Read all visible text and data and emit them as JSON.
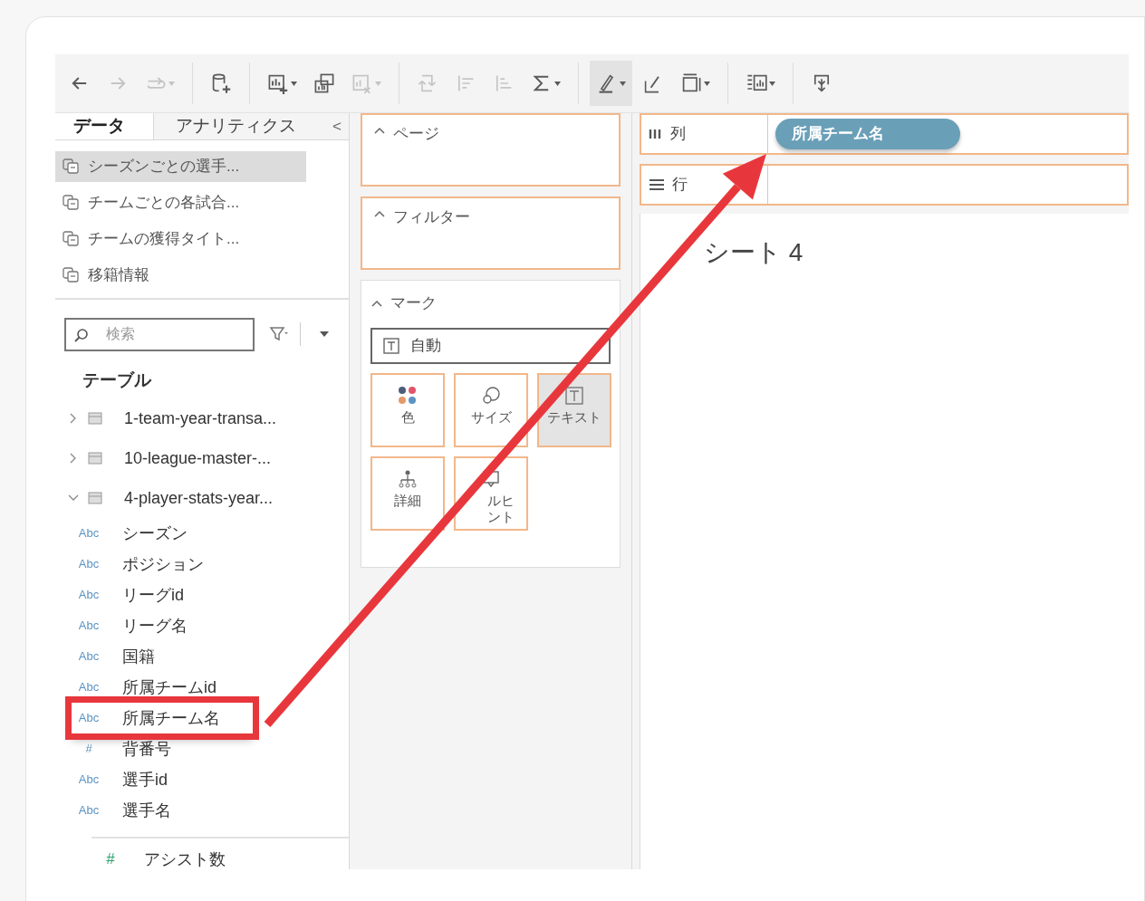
{
  "toolbar": [
    {
      "kind": "back",
      "disabled": false,
      "dropdown": false
    },
    {
      "kind": "forward",
      "disabled": true,
      "dropdown": false
    },
    {
      "kind": "redo",
      "disabled": true,
      "dropdown": true
    },
    {
      "kind": "separator"
    },
    {
      "kind": "new-datasource",
      "disabled": false,
      "dropdown": false
    },
    {
      "kind": "separator"
    },
    {
      "kind": "new-sheet",
      "disabled": false,
      "dropdown": true
    },
    {
      "kind": "duplicate",
      "disabled": false,
      "dropdown": false
    },
    {
      "kind": "clear",
      "disabled": true,
      "dropdown": true
    },
    {
      "kind": "separator"
    },
    {
      "kind": "swap",
      "disabled": true,
      "dropdown": false
    },
    {
      "kind": "sort-asc",
      "disabled": true,
      "dropdown": false
    },
    {
      "kind": "sort-desc",
      "disabled": true,
      "dropdown": false
    },
    {
      "kind": "totals",
      "disabled": false,
      "dropdown": true
    },
    {
      "kind": "separator"
    },
    {
      "kind": "highlight",
      "disabled": false,
      "dropdown": true,
      "pressed": true
    },
    {
      "kind": "annotate",
      "disabled": false,
      "dropdown": false
    },
    {
      "kind": "frame",
      "disabled": false,
      "dropdown": true
    },
    {
      "kind": "separator"
    },
    {
      "kind": "show-me",
      "disabled": false,
      "dropdown": true
    },
    {
      "kind": "separator"
    },
    {
      "kind": "present",
      "disabled": false,
      "dropdown": false
    }
  ],
  "data_pane": {
    "tabs": [
      {
        "label": "データ",
        "selected": true
      },
      {
        "label": "アナリティクス",
        "selected": false
      }
    ],
    "collapse": "<",
    "datasources": [
      {
        "label": "シーズンごとの選手...",
        "selected": true
      },
      {
        "label": "チームごとの各試合...",
        "selected": false
      },
      {
        "label": "チームの獲得タイト...",
        "selected": false
      },
      {
        "label": "移籍情報",
        "selected": false
      }
    ],
    "search": {
      "placeholder": "検索"
    },
    "section": "テーブル",
    "tables": [
      {
        "label": "1-team-year-transa...",
        "expanded": false
      },
      {
        "label": "10-league-master-...",
        "expanded": false
      },
      {
        "label": "4-player-stats-year...",
        "expanded": true,
        "children": [
          {
            "label": "シーズン",
            "type": "Abc",
            "kind": "dimension",
            "annotated": false
          },
          {
            "label": "ポジション",
            "type": "Abc",
            "kind": "dimension",
            "annotated": false
          },
          {
            "label": "リーグid",
            "type": "Abc",
            "kind": "dimension",
            "annotated": false
          },
          {
            "label": "リーグ名",
            "type": "Abc",
            "kind": "dimension",
            "annotated": false
          },
          {
            "label": "国籍",
            "type": "Abc",
            "kind": "dimension",
            "annotated": false
          },
          {
            "label": "所属チームid",
            "type": "Abc",
            "kind": "dimension",
            "annotated": false
          },
          {
            "label": "所属チーム名",
            "type": "Abc",
            "kind": "dimension",
            "annotated": true
          },
          {
            "label": "背番号",
            "type": "#",
            "kind": "dimension",
            "annotated": false
          },
          {
            "label": "選手id",
            "type": "Abc",
            "kind": "dimension",
            "annotated": false
          },
          {
            "label": "選手名",
            "type": "Abc",
            "kind": "dimension",
            "annotated": false
          },
          {
            "label": "アシスト数",
            "type": "#",
            "kind": "measure",
            "annotated": false
          }
        ]
      }
    ]
  },
  "shelves": {
    "pages": "ページ",
    "filters": "フィルター",
    "marks": {
      "title": "マーク",
      "mark_type": "自動",
      "cards": [
        {
          "label": "色",
          "kind": "color",
          "pressed": false
        },
        {
          "label": "サイズ",
          "kind": "size",
          "pressed": false
        },
        {
          "label": "テキスト",
          "kind": "text",
          "pressed": true
        },
        {
          "label": "詳細",
          "kind": "detail",
          "pressed": false
        },
        {
          "label": "ルヒント",
          "kind": "tooltip",
          "pressed": false
        }
      ]
    }
  },
  "view": {
    "columns": {
      "label": "列",
      "pills": [
        "所属チーム名"
      ]
    },
    "rows": {
      "label": "行"
    },
    "sheet_title": "シート 4"
  }
}
